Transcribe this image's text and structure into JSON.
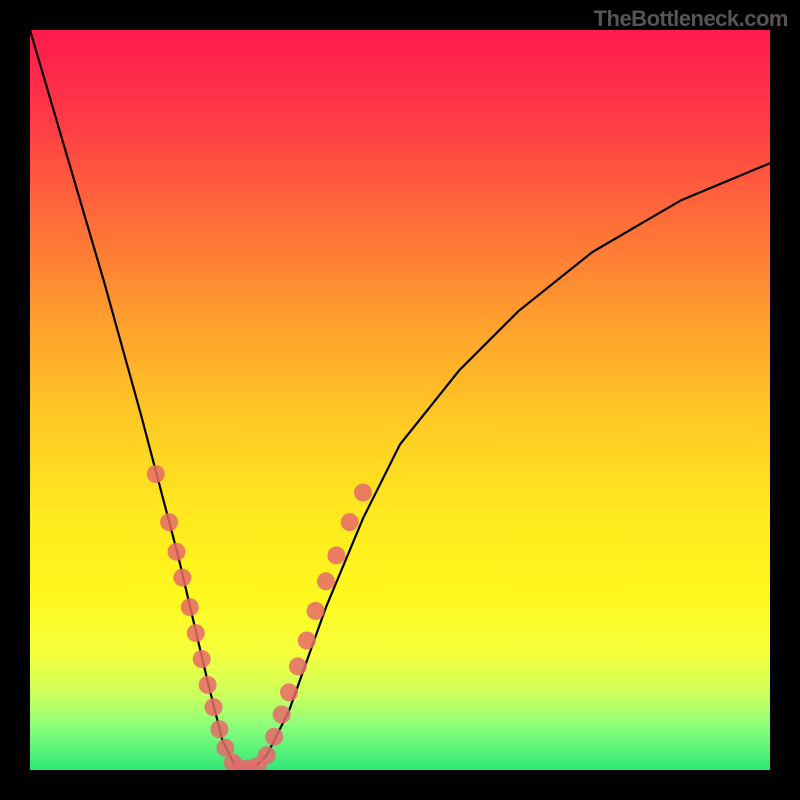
{
  "watermark": "TheBottleneck.com",
  "chart_data": {
    "type": "line",
    "title": "",
    "xlabel": "",
    "ylabel": "",
    "xlim": [
      0,
      100
    ],
    "ylim": [
      0,
      100
    ],
    "grid": false,
    "series": [
      {
        "name": "curve",
        "color": "#000000",
        "x": [
          0,
          5,
          10,
          15,
          20,
          24,
          26,
          28,
          30,
          32,
          35,
          40,
          45,
          50,
          58,
          66,
          76,
          88,
          100
        ],
        "values": [
          100,
          83,
          66,
          48,
          29,
          12,
          4,
          0,
          0,
          2,
          8,
          22,
          34,
          44,
          54,
          62,
          70,
          77,
          82
        ]
      }
    ],
    "marker_clusters": [
      {
        "name": "left-cluster",
        "color": "#e66a6a",
        "points": [
          {
            "x": 17.0,
            "y": 40.0
          },
          {
            "x": 18.8,
            "y": 33.5
          },
          {
            "x": 19.8,
            "y": 29.5
          },
          {
            "x": 20.6,
            "y": 26.0
          },
          {
            "x": 21.6,
            "y": 22.0
          },
          {
            "x": 22.4,
            "y": 18.5
          },
          {
            "x": 23.2,
            "y": 15.0
          },
          {
            "x": 24.0,
            "y": 11.5
          },
          {
            "x": 24.8,
            "y": 8.5
          },
          {
            "x": 25.6,
            "y": 5.5
          },
          {
            "x": 26.4,
            "y": 3.0
          },
          {
            "x": 27.4,
            "y": 1.0
          },
          {
            "x": 28.4,
            "y": 0.2
          },
          {
            "x": 29.6,
            "y": 0.2
          }
        ]
      },
      {
        "name": "right-cluster",
        "color": "#e66a6a",
        "points": [
          {
            "x": 30.8,
            "y": 0.6
          },
          {
            "x": 32.0,
            "y": 2.0
          },
          {
            "x": 33.0,
            "y": 4.5
          },
          {
            "x": 34.0,
            "y": 7.5
          },
          {
            "x": 35.0,
            "y": 10.5
          },
          {
            "x": 36.2,
            "y": 14.0
          },
          {
            "x": 37.4,
            "y": 17.5
          },
          {
            "x": 38.6,
            "y": 21.5
          },
          {
            "x": 40.0,
            "y": 25.5
          },
          {
            "x": 41.4,
            "y": 29.0
          },
          {
            "x": 43.2,
            "y": 33.5
          },
          {
            "x": 45.0,
            "y": 37.5
          }
        ]
      }
    ]
  }
}
